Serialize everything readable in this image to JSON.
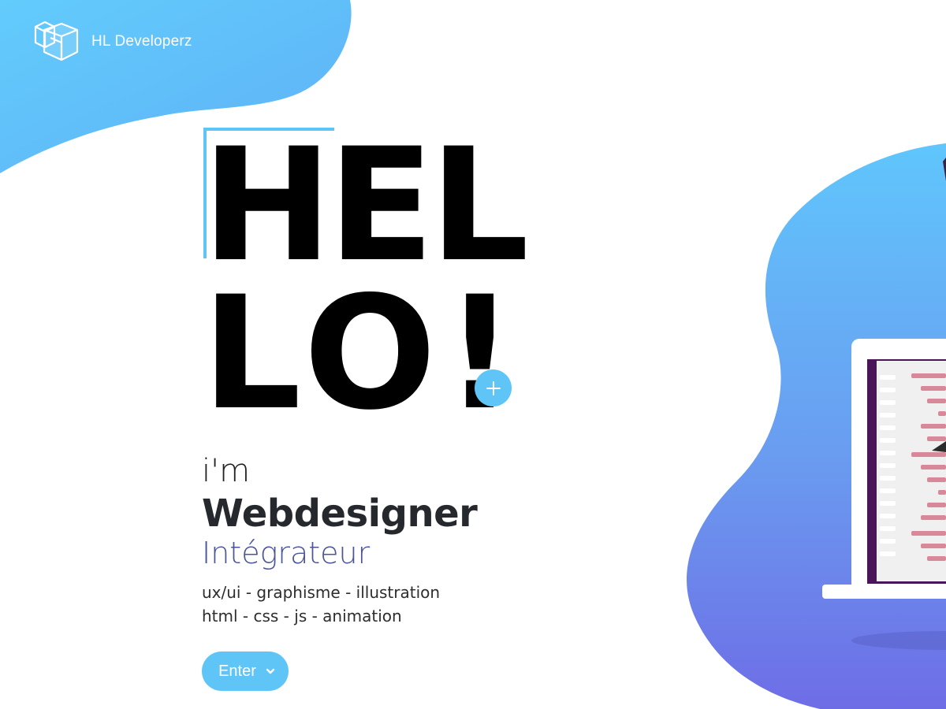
{
  "brand": {
    "name": "HL Developerz",
    "logo_icon": "cube-stack-icon"
  },
  "hero": {
    "headline_line1": "HEL",
    "headline_line2": "LO!",
    "plus_icon": "plus-icon",
    "intro": "i'm",
    "role_primary": "Webdesigner",
    "role_secondary": "Intégrateur",
    "skills_line1": "ux/ui - graphisme - illustration",
    "skills_line2": "html - css - js - animation"
  },
  "cta": {
    "label": "Enter",
    "icon": "chevron-down-icon"
  },
  "illustration": {
    "subject": "laptop-code-icon"
  },
  "colors": {
    "accent": "#5fc5f7",
    "blob_top": "#62c4fb",
    "blob_bottom": "#6b73e6",
    "laptop_screen": "#4a1458",
    "code_lines": "#d9889a",
    "headline": "#000000",
    "role_secondary": "#4a5499"
  }
}
